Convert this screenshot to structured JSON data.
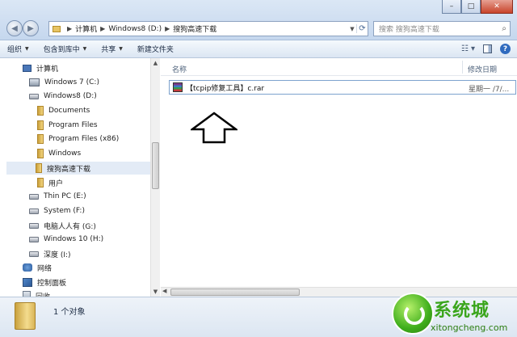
{
  "address": {
    "crumbs": [
      "计算机",
      "Windows8 (D:)",
      "搜狗高速下载"
    ],
    "search_placeholder": "搜索 搜狗高速下载"
  },
  "window_controls": {
    "minimize": "–",
    "maximize": "□",
    "close": "✕"
  },
  "toolbar": {
    "organize": "组织",
    "include_in_library": "包含到库中",
    "share": "共享",
    "new_folder": "新建文件夹"
  },
  "navpane": {
    "items": [
      {
        "label": "计算机",
        "icon": "computer-icon"
      },
      {
        "label": "Windows 7  (C:)",
        "icon": "system-drive-icon"
      },
      {
        "label": "Windows8 (D:)",
        "icon": "drive-icon"
      },
      {
        "label": "Documents",
        "icon": "folder-icon"
      },
      {
        "label": "Program Files",
        "icon": "folder-icon"
      },
      {
        "label": "Program Files (x86)",
        "icon": "folder-icon"
      },
      {
        "label": "Windows",
        "icon": "folder-icon"
      },
      {
        "label": "搜狗高速下载",
        "icon": "folder-icon",
        "selected": true
      },
      {
        "label": "用户",
        "icon": "folder-icon"
      },
      {
        "label": "Thin PC (E:)",
        "icon": "drive-icon"
      },
      {
        "label": "System (F:)",
        "icon": "drive-icon"
      },
      {
        "label": "电脑人人有 (G:)",
        "icon": "drive-icon"
      },
      {
        "label": "Windows 10 (H:)",
        "icon": "drive-icon"
      },
      {
        "label": "深度 (I:)",
        "icon": "drive-icon"
      },
      {
        "label": "网络",
        "icon": "network-icon"
      },
      {
        "label": "控制面板",
        "icon": "control-panel-icon"
      },
      {
        "label": "回收",
        "icon": "recycle-bin-icon"
      }
    ]
  },
  "content": {
    "columns": {
      "name": "名称",
      "date": "修改日期"
    },
    "files": [
      {
        "name": "【tcpip修复工具】c.rar",
        "date": "星期一 /7/..."
      }
    ]
  },
  "status": {
    "text": "1 个对象"
  },
  "watermark": {
    "text": "系统城",
    "url": "xitongcheng.com"
  }
}
